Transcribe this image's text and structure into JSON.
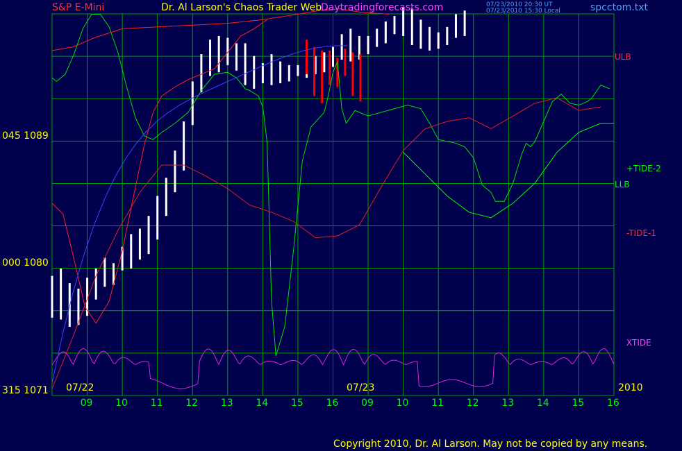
{
  "header": {
    "symbol": "S&P E-Mini",
    "title": "Dr. Al Larson's Chaos Trader Web",
    "site": "Daytradingforecasts.com",
    "stamp_ut": "07/23/2010 20:30 UT",
    "stamp_local": "07/23/2010 15:30 Local",
    "file": "spcctom.txt"
  },
  "colors": {
    "background": "#00004d",
    "grid": "#00a000",
    "price_bar": "#ffffff",
    "price_recent": "#ff0000",
    "ulb": "#ff2020",
    "llb": "#00ff00",
    "tide_plus": "#00e000",
    "tide_minus": "#e02020",
    "xtide": "#e020e0",
    "moving_average": "#4040ff",
    "price_avg": "#ffff00",
    "label_yellow": "#ffff00",
    "label_green": "#00ff00",
    "label_magenta": "#ff44ff",
    "label_blue": "#4fa0ff",
    "label_red": "#ff3030"
  },
  "y_axis_labels": [
    {
      "text": "045  1089"
    },
    {
      "text": "000  1080"
    },
    {
      "text": "315  1071"
    }
  ],
  "series_labels": {
    "ulb": "ULB",
    "tide_plus": "+TIDE-2",
    "llb": "LLB",
    "tide_minus": "-TIDE-1",
    "xtide": "XTIDE"
  },
  "date_labels": {
    "day1": "07/22",
    "day2": "07/23",
    "year": "2010"
  },
  "copyright": "Copyright 2010, Dr. Al Larson. May not be copied by any means.",
  "chart_data": {
    "type": "line",
    "ylim": [
      1071,
      1092
    ],
    "x_ticks": [
      "09",
      "10",
      "11",
      "12",
      "13",
      "14",
      "15",
      "16",
      "09",
      "10",
      "11",
      "12",
      "13",
      "14",
      "15",
      "16"
    ],
    "price_bars": {
      "x_start": 0,
      "x_step": 0.25,
      "high": [
        1077.2,
        1077.6,
        1076.8,
        1076.5,
        1077.1,
        1077.6,
        1078.2,
        1077.9,
        1078.8,
        1079.5,
        1079.8,
        1080.5,
        1081.6,
        1082.6,
        1084.1,
        1085.7,
        1087.9,
        1089.4,
        1090.2,
        1090.4,
        1090.3,
        1090.0,
        1090.0,
        1089.3,
        1088.9,
        1089.4,
        1089.0,
        1088.8,
        1088.8,
        1089.2,
        1089.3,
        1089.5,
        1089.8,
        1090.5,
        1090.8,
        1090.4,
        1090.4,
        1090.8,
        1091.2,
        1091.5,
        1092.0,
        1091.9,
        1091.3,
        1090.9,
        1090.6,
        1090.9,
        1091.6,
        1091.8
      ],
      "low": [
        1074.9,
        1074.8,
        1074.4,
        1074.5,
        1075.0,
        1075.9,
        1076.6,
        1076.7,
        1077.5,
        1077.6,
        1078.1,
        1078.4,
        1079.2,
        1080.5,
        1081.8,
        1083.0,
        1085.5,
        1087.3,
        1088.2,
        1088.4,
        1088.8,
        1088.5,
        1087.7,
        1087.5,
        1087.8,
        1087.7,
        1087.8,
        1087.9,
        1088.2,
        1088.1,
        1088.3,
        1088.4,
        1088.7,
        1089.1,
        1089.0,
        1089.1,
        1089.4,
        1089.8,
        1090.0,
        1090.5,
        1090.4,
        1089.9,
        1089.7,
        1089.6,
        1089.7,
        1089.9,
        1090.3,
        1090.4
      ],
      "red_high": [
        1090.2,
        1089.8,
        1089.6,
        1089.6,
        1089.2,
        1089.7,
        1089.5,
        1089.4
      ],
      "red_low": [
        1088.3,
        1087.1,
        1086.7,
        1087.7,
        1087.6,
        1088.2,
        1087.1,
        1086.8
      ],
      "red_x_start": 11.6,
      "red_x_step": 0.35
    },
    "series": [
      {
        "name": "ULB",
        "x": [
          0,
          0.3,
          1.2,
          1.9,
          2.4,
          3.0,
          3.6,
          4.1,
          5.2,
          6.0,
          6.6,
          7.2,
          8.0,
          8.6,
          9.3,
          9.8,
          10.1
        ],
        "y": [
          1081.0,
          1080.8,
          1079.5,
          1076.5,
          1074.6,
          1074.8,
          1077.0,
          1082.1,
          1087.4,
          1089.4,
          1089.7,
          1090.0,
          1091.1,
          1091.5,
          1091.7,
          1091.5,
          1091.1
        ]
      },
      {
        "name": "LLB",
        "x": [
          0,
          0.3,
          0.7,
          1.3,
          2.0,
          2.6,
          3.3,
          4.2,
          5.5,
          6.6,
          7.5,
          8.2,
          9.0,
          9.6,
          10.1
        ],
        "y": [
          1071.0,
          1071.9,
          1074.3,
          1075.7,
          1078.4,
          1082.0,
          1084.6,
          1086.5,
          1087.3,
          1087.9,
          1088.2,
          1088.5,
          1087.9,
          1087.4,
          1086.8
        ]
      },
      {
        "name": "+TIDE-2",
        "x": [
          0,
          0.4,
          1.0,
          1.5,
          2.2,
          2.7,
          3.2,
          3.8,
          4.2,
          4.8,
          5.5,
          6.0,
          6.6,
          7.3,
          8.0,
          8.6,
          9.3,
          9.9,
          10.3,
          10.6,
          11.2,
          11.8,
          12.4,
          13.0,
          13.8,
          14.6,
          15.2,
          15.7,
          16.3,
          16.9,
          17.6,
          18.2,
          18.8,
          19.3,
          19.7,
          20.2,
          20.8,
          21.4,
          22.0,
          22.6,
          23.0,
          23.5,
          24.0,
          24.5,
          25.0,
          25.5,
          26.0,
          26.7,
          27.2,
          28.0,
          28.6,
          29.6,
          30.4,
          31.0,
          31.6,
          32.1,
          32.5,
          33.2,
          33.8,
          34.2,
          34.6,
          35.0,
          35.6,
          36.3,
          36.9,
          37.5,
          38.2,
          39.0,
          39.8,
          40.7,
          41.5,
          42.2,
          42.8,
          43.5,
          44.3,
          45.0,
          45.7,
          46.5,
          47.2,
          48.0,
          48.7,
          49.3,
          50.0,
          50.7,
          51.4,
          52.0,
          52.8,
          53.5,
          54.2,
          55.0,
          55.7,
          56.4,
          57.0,
          57.6,
          58.2,
          58.7,
          59.2,
          59.6,
          59.8,
          60.0,
          60.2,
          60.6,
          61.1,
          61.6,
          62.2,
          62.6,
          63.1,
          63.6,
          64.0,
          64.5,
          65.0,
          65.4,
          65.8,
          66.2,
          66.6,
          67.0,
          67.4,
          67.8,
          68.2,
          68.6,
          69.0,
          69.4,
          69.8,
          70.0
        ],
        "y": [
          1088.1,
          1087.9,
          1087.9,
          1088.0,
          1089.1,
          1090.4,
          1091.2,
          1091.6,
          1091.5,
          1091.1,
          1089.9,
          1088.3,
          1086.9,
          1085.6,
          1085.0,
          1084.9,
          1084.9,
          1085.1,
          1085.7,
          1086.2,
          1087.2,
          1087.7,
          1088.2,
          1088.5,
          1088.1,
          1088.0,
          1087.2,
          1087.0,
          1086.3,
          1085.8,
          1085.3,
          1084.8,
          1084.5,
          1084.3,
          1084.2,
          1084.1,
          1083.9,
          1083.4,
          1083.4,
          1083.4,
          1083.4,
          1083.4,
          1083.4,
          1083.4,
          1083.4,
          1083.4,
          1083.4,
          1083.4,
          1083.4,
          1083.4,
          1083.4,
          1083.4,
          1083.4,
          1083.4,
          1083.4,
          1083.4,
          1083.4,
          1083.4,
          1083.4,
          1083.4,
          1083.4,
          1083.4,
          1083.4,
          1083.4,
          1083.4,
          1083.4,
          1083.4,
          1083.4,
          1083.4,
          1083.4,
          1083.4,
          1083.4,
          1083.4,
          1083.4,
          1083.4,
          1083.4,
          1083.4,
          1083.4,
          1083.4,
          1083.4,
          1083.4,
          1083.4,
          1083.4,
          1083.4,
          1083.4,
          1083.4,
          1083.4,
          1083.4,
          1083.4,
          1083.4,
          1083.4,
          1083.4,
          1083.4,
          1083.4,
          1083.4,
          1083.4,
          1083.4,
          1083.4,
          1083.4,
          1083.4,
          1083.4,
          1083.4,
          1083.4,
          1083.4,
          1083.4,
          1083.4,
          1083.4,
          1083.4,
          1083.4,
          1083.4,
          1083.4,
          1083.4,
          1083.4,
          1083.4,
          1083.4,
          1083.4,
          1083.4,
          1083.4,
          1083.4,
          1083.4,
          1083.4,
          1083.4,
          1083.4,
          1083.4
        ]
      }
    ],
    "lines": {
      "ulb": [
        [
          0,
          1081.2
        ],
        [
          0.5,
          1080.6
        ],
        [
          1.0,
          1078.1
        ],
        [
          1.5,
          1075.5
        ],
        [
          2.0,
          1074.6
        ],
        [
          2.6,
          1075.8
        ],
        [
          3.2,
          1078.6
        ],
        [
          3.8,
          1082.1
        ],
        [
          4.2,
          1084.4
        ],
        [
          4.6,
          1086.2
        ],
        [
          5.0,
          1087.1
        ],
        [
          5.6,
          1087.6
        ],
        [
          6.2,
          1088.0
        ],
        [
          6.8,
          1088.3
        ],
        [
          7.4,
          1088.6
        ],
        [
          8.0,
          1089.5
        ],
        [
          8.6,
          1090.4
        ],
        [
          9.2,
          1090.8
        ],
        [
          9.8,
          1091.3
        ]
      ],
      "tide_plus": [
        [
          0,
          1088.1
        ],
        [
          0.2,
          1087.9
        ],
        [
          0.6,
          1088.3
        ],
        [
          1.0,
          1089.4
        ],
        [
          1.4,
          1090.8
        ],
        [
          1.8,
          1091.6
        ],
        [
          2.2,
          1091.6
        ],
        [
          2.6,
          1090.9
        ],
        [
          3.0,
          1089.5
        ],
        [
          3.4,
          1087.6
        ],
        [
          3.8,
          1085.9
        ],
        [
          4.2,
          1084.9
        ],
        [
          4.6,
          1084.7
        ],
        [
          5.0,
          1085.1
        ],
        [
          5.6,
          1085.6
        ],
        [
          6.2,
          1086.2
        ],
        [
          6.8,
          1087.4
        ],
        [
          7.4,
          1088.3
        ],
        [
          8.0,
          1088.4
        ],
        [
          8.4,
          1088.1
        ],
        [
          8.8,
          1087.5
        ],
        [
          9.0,
          1087.4
        ],
        [
          9.4,
          1087.1
        ],
        [
          9.6,
          1086.5
        ],
        [
          9.8,
          1084.5
        ],
        [
          10.0,
          1075.8
        ],
        [
          10.2,
          1072.8
        ],
        [
          10.6,
          1074.4
        ],
        [
          11.0,
          1078.6
        ],
        [
          11.4,
          1083.5
        ],
        [
          11.8,
          1085.4
        ],
        [
          12.4,
          1086.2
        ],
        [
          12.6,
          1087.2
        ],
        [
          12.8,
          1088.4
        ],
        [
          13.0,
          1089.0
        ],
        [
          13.2,
          1086.4
        ],
        [
          13.4,
          1085.6
        ],
        [
          13.8,
          1086.3
        ],
        [
          14.4,
          1086.0
        ],
        [
          15.0,
          1086.2
        ],
        [
          15.6,
          1086.4
        ],
        [
          16.2,
          1086.6
        ],
        [
          16.8,
          1086.4
        ],
        [
          17.2,
          1085.6
        ],
        [
          17.6,
          1084.7
        ],
        [
          18.0,
          1084.6
        ],
        [
          18.4,
          1084.5
        ],
        [
          18.8,
          1084.3
        ],
        [
          19.2,
          1083.7
        ],
        [
          19.6,
          1082.2
        ],
        [
          20.0,
          1081.8
        ],
        [
          20.2,
          1081.3
        ],
        [
          20.6,
          1081.3
        ],
        [
          21.0,
          1082.3
        ],
        [
          21.4,
          1083.9
        ],
        [
          21.6,
          1084.5
        ],
        [
          21.8,
          1084.3
        ],
        [
          22.0,
          1084.6
        ],
        [
          22.4,
          1085.7
        ],
        [
          22.8,
          1086.8
        ],
        [
          23.2,
          1087.2
        ],
        [
          23.6,
          1086.7
        ],
        [
          24.0,
          1086.6
        ],
        [
          24.4,
          1086.8
        ],
        [
          24.6,
          1087.0
        ],
        [
          25.0,
          1087.7
        ],
        [
          25.4,
          1087.5
        ]
      ]
    }
  }
}
